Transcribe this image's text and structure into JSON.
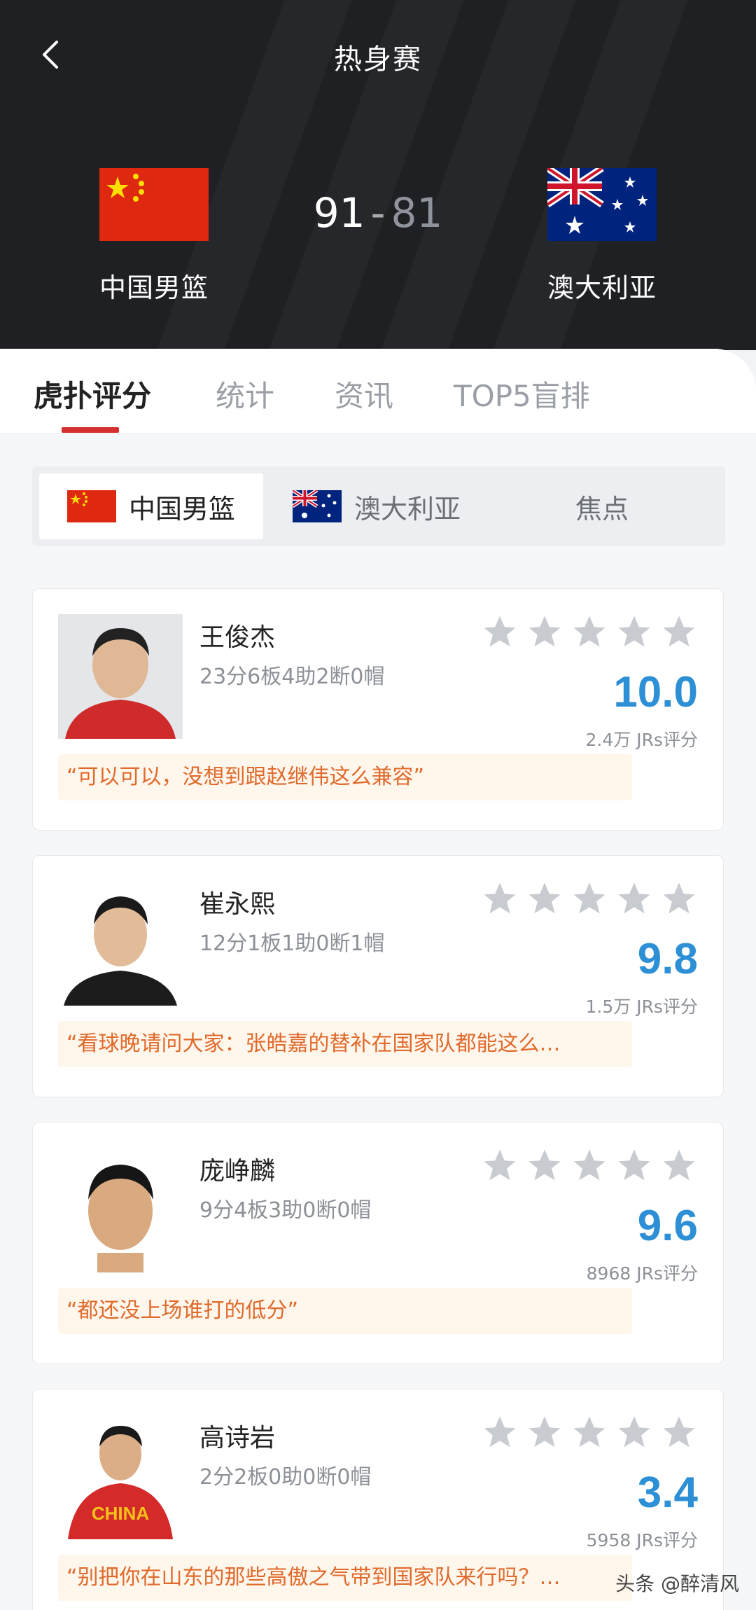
{
  "header": {
    "title": "热身赛",
    "home_team": "中国男篮",
    "away_team": "澳大利亚",
    "home_score": "91",
    "separator": "-",
    "away_score": "81"
  },
  "tabs": [
    {
      "label": "虎扑评分",
      "active": true
    },
    {
      "label": "统计",
      "active": false
    },
    {
      "label": "资讯",
      "active": false
    },
    {
      "label": "TOP5盲排",
      "active": false
    }
  ],
  "segment": [
    {
      "label": "中国男篮",
      "icon": "china-flag-icon",
      "active": true
    },
    {
      "label": "澳大利亚",
      "icon": "australia-flag-icon",
      "active": false
    },
    {
      "label": "焦点",
      "active": false
    }
  ],
  "players": [
    {
      "name": "王俊杰",
      "stats": "23分6板4助2断0帽",
      "rating": "10.0",
      "votes": "2.4万 JRs评分",
      "quote": "“可以可以，没想到跟赵继伟这么兼容”"
    },
    {
      "name": "崔永熙",
      "stats": "12分1板1助0断1帽",
      "rating": "9.8",
      "votes": "1.5万 JRs评分",
      "quote": "“看球晚请问大家：张皓嘉的替补在国家队都能这么…"
    },
    {
      "name": "庞峥麟",
      "stats": "9分4板3助0断0帽",
      "rating": "9.6",
      "votes": "8968 JRs评分",
      "quote": "“都还没上场谁打的低分”"
    },
    {
      "name": "高诗岩",
      "stats": "2分2板0助0断0帽",
      "rating": "3.4",
      "votes": "5958 JRs评分",
      "quote": "“别把你在山东的那些高傲之气带到国家队来行吗？…"
    }
  ],
  "watermark": "头条 @醉清风",
  "colors": {
    "header_bg": "#1f2024",
    "accent_red": "#d62f2f",
    "rating_blue": "#2d8fd5",
    "quote_orange": "#e06a2b",
    "star_gray": "#c8cbd0"
  }
}
